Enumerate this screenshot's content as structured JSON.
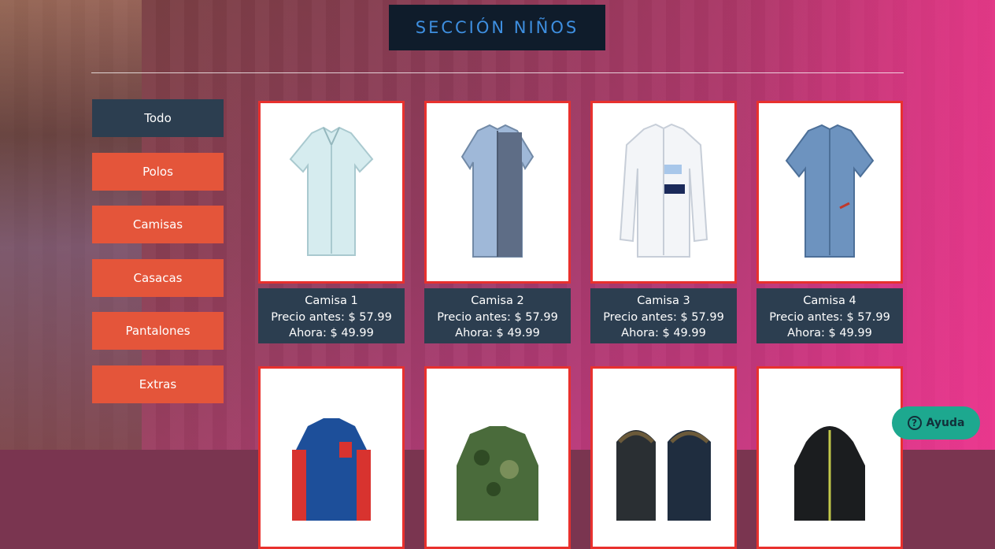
{
  "header": {
    "title": "SECCIÓN NIÑOS"
  },
  "nav": {
    "items": [
      "Todo",
      "Polos",
      "Camisas",
      "Casacas",
      "Pantalones",
      "Extras"
    ],
    "active_index": 0
  },
  "products": [
    {
      "name": "Camisa 1",
      "price_before": "Precio antes: $ 57.99",
      "price_now": "Ahora: $ 49.99",
      "image_icon": "light-blue-shortsleeve-shirt"
    },
    {
      "name": "Camisa 2",
      "price_before": "Precio antes: $ 57.99",
      "price_now": "Ahora: $ 49.99",
      "image_icon": "two-tone-blue-shirt"
    },
    {
      "name": "Camisa 3",
      "price_before": "Precio antes: $ 57.99",
      "price_now": "Ahora: $ 49.99",
      "image_icon": "white-longsleeve-shirt"
    },
    {
      "name": "Camisa 4",
      "price_before": "Precio antes: $ 57.99",
      "price_now": "Ahora: $ 49.99",
      "image_icon": "denim-shirt"
    }
  ],
  "products_row2_icons": [
    "red-blue-jacket",
    "camo-jacket",
    "dark-hooded-jackets",
    "black-hooded-jacket"
  ],
  "help": {
    "label": "Ayuda",
    "icon": "question-icon"
  },
  "colors": {
    "accent": "#e4553a",
    "active": "#2c3e50",
    "title_text": "#3e8fe0",
    "card_border": "#e8312e",
    "help_bg": "#1da88f"
  }
}
